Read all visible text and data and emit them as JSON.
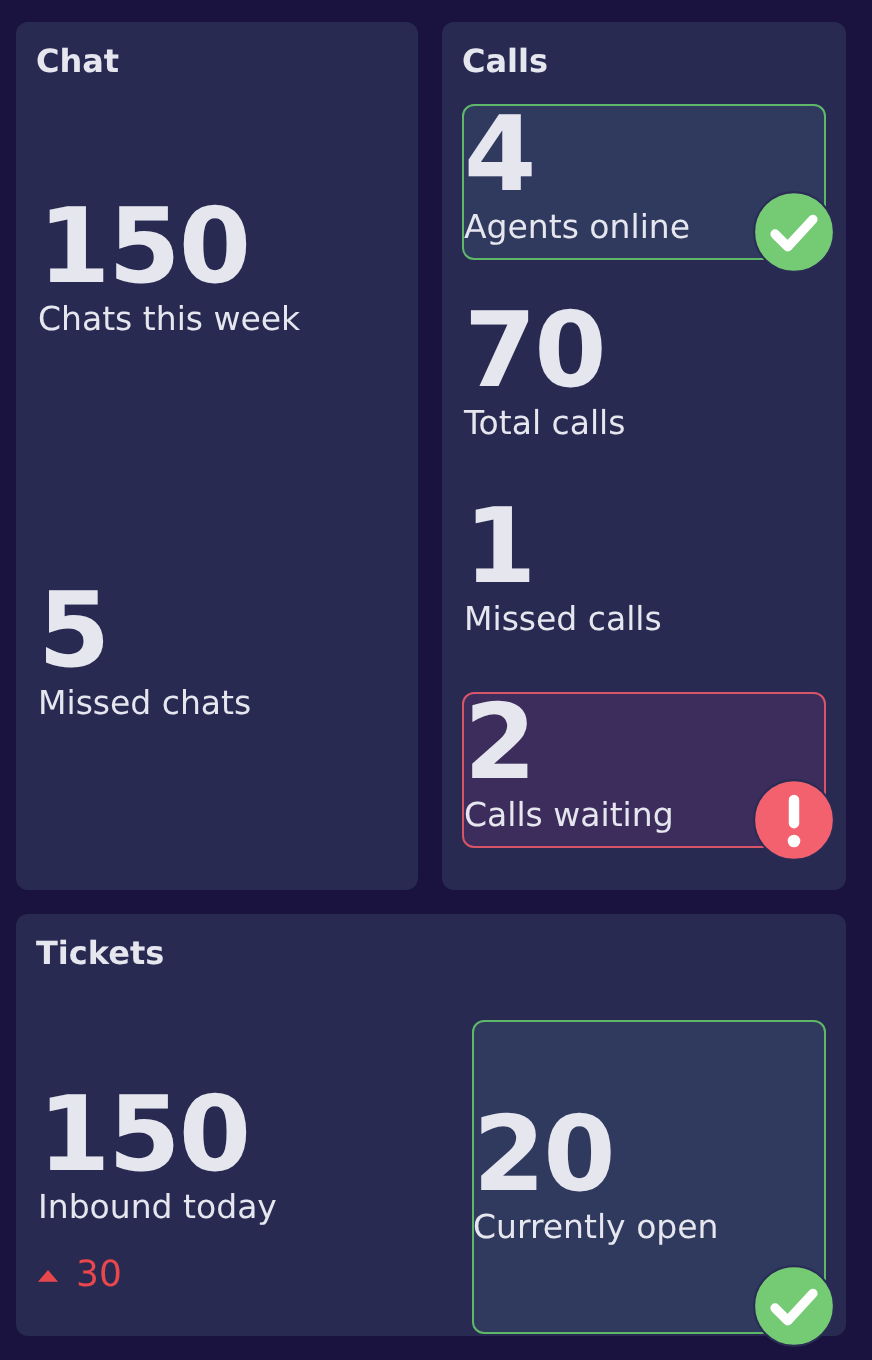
{
  "panels": [
    {
      "title": "Chat",
      "stats": [
        {
          "value": "150",
          "label": "Chats this week",
          "kind": "plain"
        },
        {
          "value": "5",
          "label": "Missed chats",
          "kind": "plain"
        }
      ]
    },
    {
      "title": "Calls",
      "stats": [
        {
          "value": "4",
          "label": "Agents online",
          "kind": "ok"
        },
        {
          "value": "70",
          "label": "Total calls",
          "kind": "plain"
        },
        {
          "value": "1",
          "label": "Missed calls",
          "kind": "plain"
        },
        {
          "value": "2",
          "label": "Calls waiting",
          "kind": "alert"
        }
      ]
    },
    {
      "title": "Tickets",
      "stats": [
        {
          "value": "150",
          "label": "Inbound today",
          "kind": "plain",
          "trend": {
            "up": true,
            "value": "30"
          }
        },
        {
          "value": "20",
          "label": "Currently open",
          "kind": "ok"
        }
      ]
    }
  ]
}
